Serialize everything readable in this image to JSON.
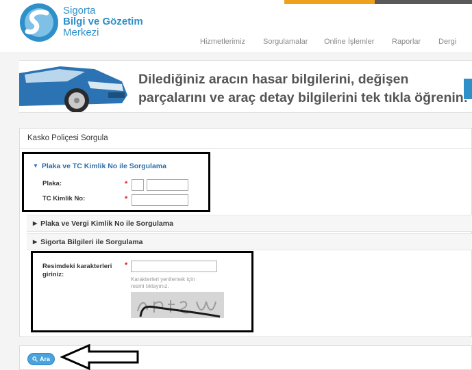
{
  "header": {
    "logo_line1": "Sigorta",
    "logo_line2": "Bilgi ve Gözetim",
    "logo_line3": "Merkezi",
    "nav": [
      "Hizmetlerimiz",
      "Sorgulamalar",
      "Online İşlemler",
      "Raporlar",
      "Dergi"
    ]
  },
  "banner": {
    "line1": "Dilediğiniz aracın hasar bilgilerini, değişen",
    "line2": "parçalarını ve araç detay bilgilerini tek tıkla öğrenin!"
  },
  "form": {
    "title": "Kasko Poliçesi Sorgula",
    "section_plate_tc": "Plaka ve TC Kimlik No ile Sorgulama",
    "plate_label": "Plaka:",
    "tc_label": "TC Kimlik No:",
    "plate_city_value": "",
    "plate_number_value": "",
    "tc_value": "",
    "section_plate_tax": "Plaka ve Vergi Kimlik No ile Sorgulama",
    "section_insurance": "Sigorta Bilgileri ile Sorgulama",
    "captcha_label_line1": "Resimdeki karakterleri",
    "captcha_label_line2": "giriniz:",
    "captcha_value": "",
    "captcha_hint_line1": "Karakterleri yenilemek için",
    "captcha_hint_line2": "resmi tıklayınız.",
    "required_mark": "*"
  },
  "actions": {
    "search_label": "Ara"
  },
  "colors": {
    "brand_blue": "#2e8fc9",
    "active_section": "#2e6ea8",
    "required_red": "#d21f1f",
    "accent_orange": "#f0a11b"
  }
}
